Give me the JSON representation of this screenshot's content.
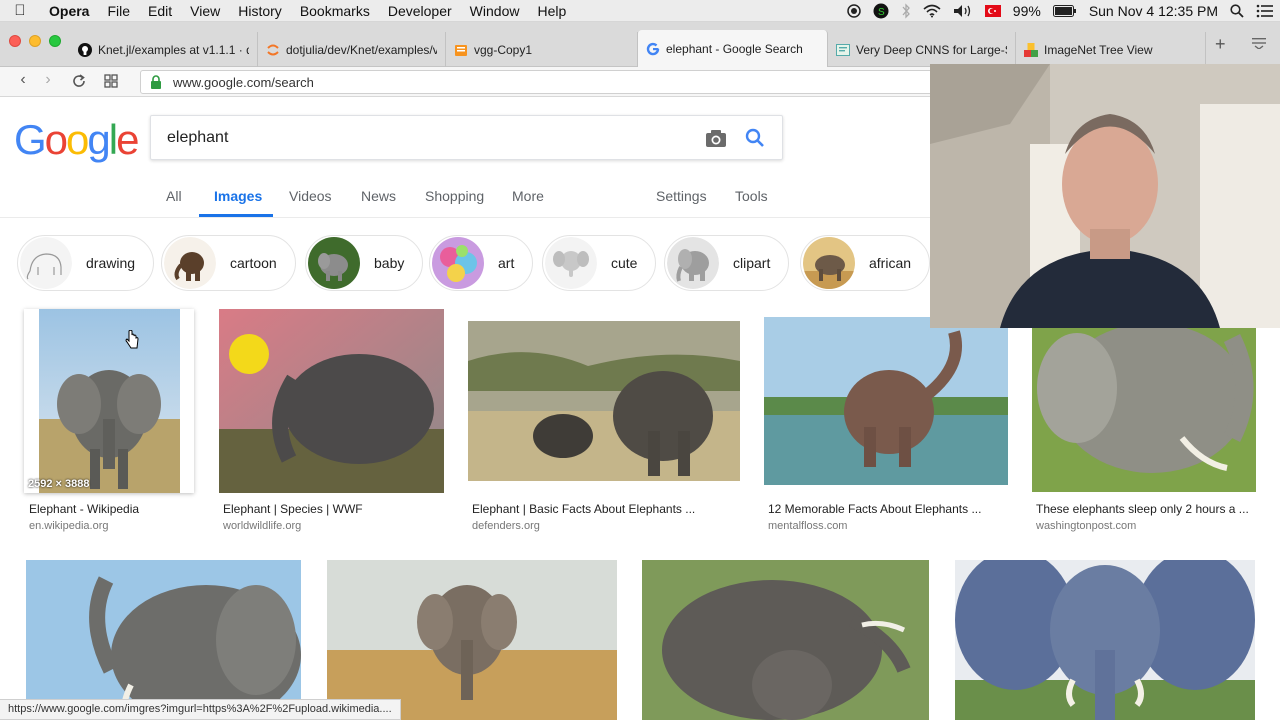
{
  "menubar": {
    "app": "Opera",
    "items": [
      "File",
      "Edit",
      "View",
      "History",
      "Bookmarks",
      "Developer",
      "Window",
      "Help"
    ],
    "battery": "99%",
    "clock": "Sun Nov 4  12:35 PM"
  },
  "tabs": [
    {
      "label": "Knet.jl/examples at v1.1.1 · de",
      "icon": "github-icon"
    },
    {
      "label": "dotjulia/dev/Knet/examples/v",
      "icon": "jupyter-icon"
    },
    {
      "label": "vgg-Copy1",
      "icon": "notebook-icon"
    },
    {
      "label": "elephant - Google Search",
      "icon": "google-icon"
    },
    {
      "label": "Very Deep CNNS for Large-S",
      "icon": "paper-icon"
    },
    {
      "label": "ImageNet Tree View",
      "icon": "imagenet-icon"
    }
  ],
  "address": {
    "url": "www.google.com/search"
  },
  "google": {
    "logo": "Google",
    "query": "elephant",
    "tabs": [
      "All",
      "Images",
      "Videos",
      "News",
      "Shopping",
      "More"
    ],
    "right_tabs": [
      "Settings",
      "Tools"
    ],
    "active_tab": "Images"
  },
  "chips": [
    "drawing",
    "cartoon",
    "baby",
    "art",
    "cute",
    "clipart",
    "african"
  ],
  "results_row1": [
    {
      "title": "Elephant - Wikipedia",
      "site": "en.wikipedia.org",
      "dimensions": "2592 × 3888"
    },
    {
      "title": "Elephant | Species | WWF",
      "site": "worldwildlife.org"
    },
    {
      "title": "Elephant | Basic Facts About Elephants ...",
      "site": "defenders.org"
    },
    {
      "title": "12 Memorable Facts About Elephants ...",
      "site": "mentalfloss.com"
    },
    {
      "title": "These elephants sleep only 2 hours a ...",
      "site": "washingtonpost.com"
    }
  ],
  "status_url": "https://www.google.com/imgres?imgurl=https%3A%2F%2Fupload.wikimedia....",
  "colors": {
    "google_blue": "#4285f4",
    "google_red": "#ea4335",
    "google_yellow": "#fbbc05",
    "google_green": "#34a853",
    "active_blue": "#1a73e8"
  }
}
